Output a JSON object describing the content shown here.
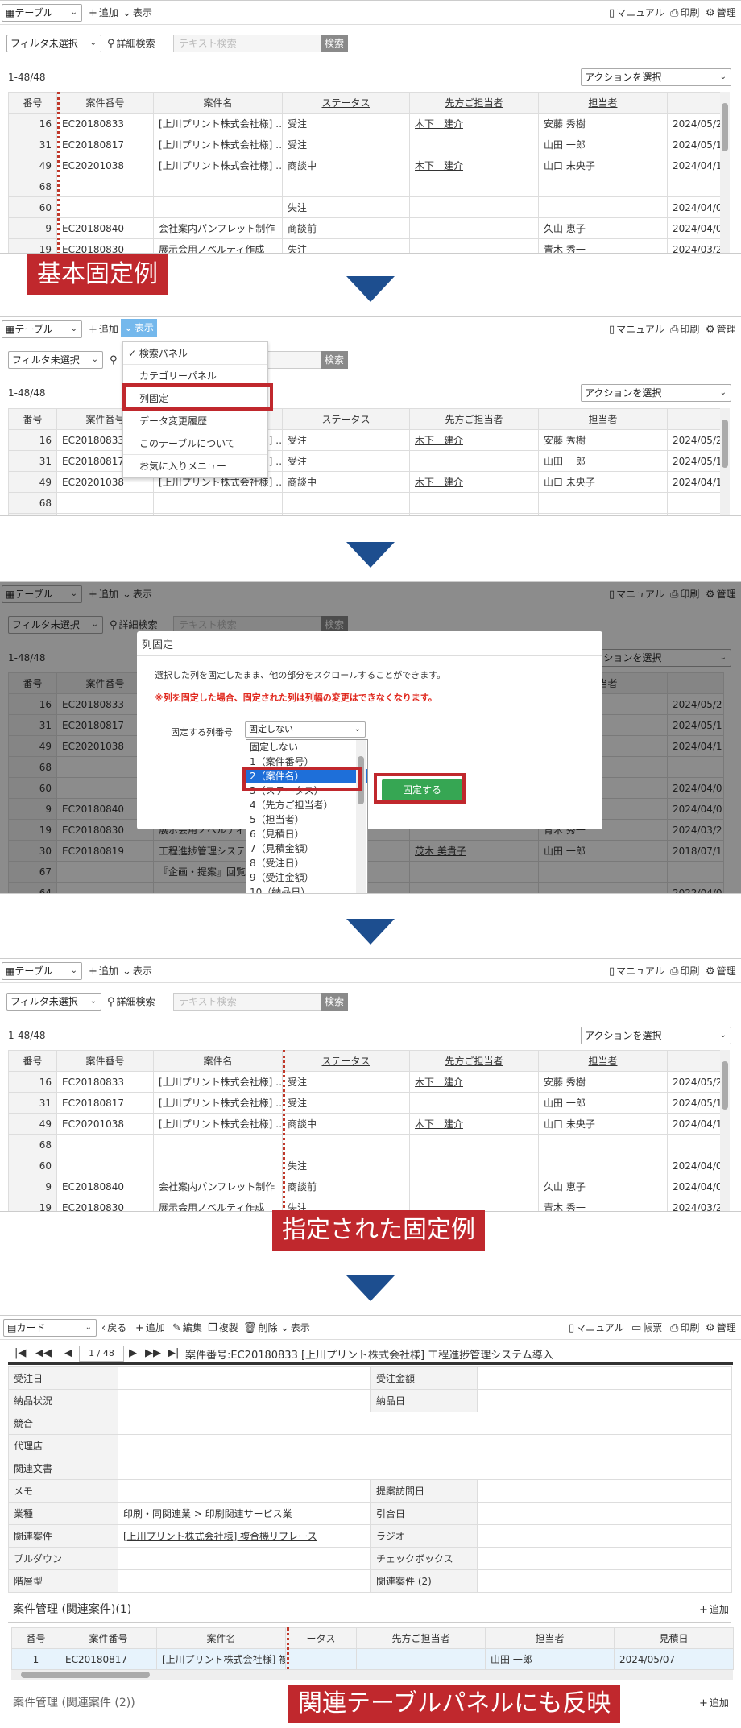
{
  "toolbar": {
    "view_table": "テーブル",
    "view_card": "カード",
    "add": "追加",
    "display": "表示",
    "manual": "マニュアル",
    "print": "印刷",
    "manage": "管理",
    "back": "戻る",
    "edit": "編集",
    "copy": "複製",
    "delete": "削除",
    "report": "帳票"
  },
  "filter": {
    "select": "フィルタ未選択",
    "advanced": "詳細検索",
    "placeholder": "テキスト検索",
    "search_btn": "検索"
  },
  "count": "1-48/48",
  "action_select": "アクションを選択",
  "columns": [
    "番号",
    "案件番号",
    "案件名",
    "ステータス",
    "先方ご担当者",
    "担当者"
  ],
  "rows": [
    [
      "16",
      "EC20180833",
      "[上川プリント株式会社様] …",
      "受注",
      "木下　建介",
      "安藤 秀樹",
      "2024/05/2"
    ],
    [
      "31",
      "EC20180817",
      "[上川プリント株式会社様] …",
      "受注",
      "",
      "山田 一郎",
      "2024/05/1"
    ],
    [
      "49",
      "EC20201038",
      "[上川プリント株式会社様] …",
      "商談中",
      "木下　建介",
      "山口 未央子",
      "2024/04/1"
    ],
    [
      "68",
      "",
      "",
      "",
      "",
      "",
      ""
    ],
    [
      "60",
      "",
      "",
      "失注",
      "",
      "",
      "2024/04/0"
    ],
    [
      "9",
      "EC20180840",
      "会社案内パンフレット制作",
      "商談前",
      "",
      "久山 恵子",
      "2024/04/0"
    ],
    [
      "19",
      "EC20180830",
      "展示会用ノベルティ作成",
      "失注",
      "",
      "青木 秀一",
      "2024/03/2"
    ]
  ],
  "modal_extra_rows": [
    [
      "30",
      "EC20180819",
      "工程進捗管理システム",
      "",
      "茂木 美貴子",
      "山田 一郎",
      "2018/07/1"
    ],
    [
      "67",
      "",
      "『企画・提案』回覧待",
      "",
      "",
      "",
      ""
    ],
    [
      "64",
      "",
      "",
      "",
      "",
      "",
      "2022/04/0"
    ]
  ],
  "label1": "基本固定例",
  "label2": "指定された固定例",
  "label3": "関連テーブルパネルにも反映",
  "menu": {
    "items": [
      "検索パネル",
      "カテゴリーパネル",
      "列固定",
      "データ変更履歴",
      "このテーブルについて",
      "お気に入りメニュー"
    ],
    "check": "✓"
  },
  "modal": {
    "title": "列固定",
    "desc": "選択した列を固定したまま、他の部分をスクロールすることができます。",
    "warn": "※列を固定した場合、固定された列は列幅の変更はできなくなります。",
    "field_label": "固定する列番号",
    "current": "固定しない",
    "submit": "固定する",
    "options": [
      "固定しない",
      "1（案件番号）",
      "2（案件名）",
      "3（ステータス）",
      "4（先方ご担当者）",
      "5（担当者）",
      "6（見積日）",
      "7（見積金額）",
      "8（受注日）",
      "9（受注金額）",
      "10（納品日）"
    ]
  },
  "card": {
    "pager": "1 / 48",
    "title": "案件番号:EC20180833 [上川プリント株式会社様] 工程進捗管理システム導入",
    "fields_left": [
      "受注日",
      "納品状況",
      "競合",
      "代理店",
      "関連文書",
      "メモ",
      "業種",
      "関連案件",
      "プルダウン",
      "階層型"
    ],
    "fields_right": [
      "受注金額",
      "納品日",
      "",
      "",
      "",
      "提案訪問日",
      "引合日",
      "ラジオ",
      "チェックボックス",
      "関連案件 (2)"
    ],
    "industry": "印刷・同関連業 > 印刷関連サービス業",
    "related": "[上川プリント株式会社様] 複合機リプレース",
    "sub_title": "案件管理 (関連案件)(1)",
    "sub_add": "追加",
    "sub_cols": [
      "番号",
      "案件番号",
      "案件名",
      "ータス",
      "先方ご担当者",
      "担当者",
      "見積日"
    ],
    "sub_row": [
      "1",
      "EC20180817",
      "[上川プリント株式会社様] 複…",
      "",
      "",
      "山田 一郎",
      "2024/05/07"
    ],
    "sub_title2": "案件管理 (関連案件 (2))"
  }
}
